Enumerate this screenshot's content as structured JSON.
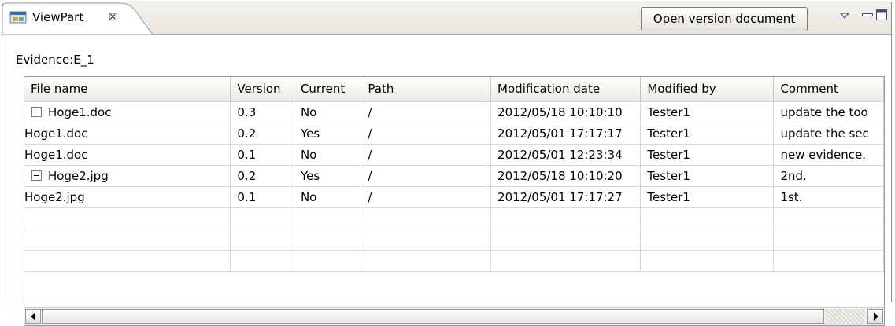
{
  "tab": {
    "title": "ViewPart",
    "icon": "viewpart-icon",
    "close_icon": "close-icon"
  },
  "toolbar": {
    "open_button_label": "Open version document"
  },
  "view_menu_icons": [
    "view-menu-icon",
    "minimize-icon",
    "maximize-icon"
  ],
  "evidence_label": "Evidence:E_1",
  "table": {
    "columns": [
      "File name",
      "Version",
      "Current",
      "Path",
      "Modification date",
      "Modified by",
      "Comment"
    ],
    "rows": [
      {
        "file": "Hoge1.doc",
        "version": "0.3",
        "current": "No",
        "path": "/",
        "date": "2012/05/18 10:10:10",
        "by": "Tester1",
        "comment": "update the too",
        "expanded": true
      },
      {
        "file": "Hoge1.doc",
        "version": "0.2",
        "current": "Yes",
        "path": "/",
        "date": "2012/05/01 17:17:17",
        "by": "Tester1",
        "comment": "update the sec"
      },
      {
        "file": "Hoge1.doc",
        "version": "0.1",
        "current": "No",
        "path": "/",
        "date": "2012/05/01 12:23:34",
        "by": "Tester1",
        "comment": "new evidence."
      },
      {
        "file": "Hoge2.jpg",
        "version": "0.2",
        "current": "Yes",
        "path": "/",
        "date": "2012/05/18 10:10:20",
        "by": "Tester1",
        "comment": "2nd.",
        "expanded": true
      },
      {
        "file": "Hoge2.jpg",
        "version": "0.1",
        "current": "No",
        "path": "/",
        "date": "2012/05/01 17:17:27",
        "by": "Tester1",
        "comment": "1st."
      }
    ]
  },
  "colors": {
    "frame_bg": "#ece9d8",
    "header_bg": "#ebeae3",
    "border": "#7f9db9"
  }
}
